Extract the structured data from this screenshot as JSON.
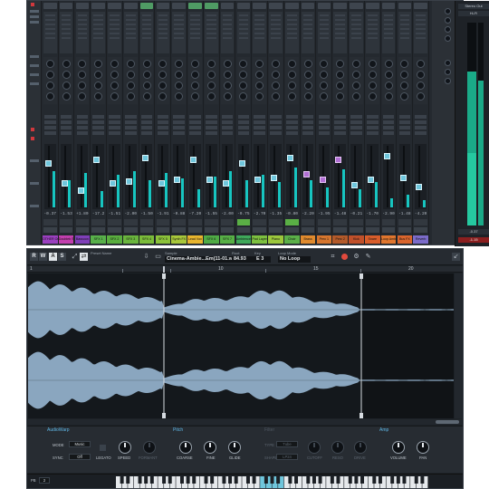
{
  "mixer": {
    "channel_values": [
      "-0.37",
      "-1.53",
      "+1.80",
      "-17.2",
      "-1.51",
      "-2.00",
      "-1.50",
      "-1.91",
      "-0.88",
      "-7.20",
      "-1.55",
      "-2.00",
      "-0.75",
      "-2.70",
      "-1.35",
      "-0.80",
      "-2.20",
      "-1.95",
      "-1.48",
      "-0.21",
      "-1.70",
      "-2.90",
      "-1.48",
      "-4.20"
    ],
    "channel_labels": [
      "OTHER Orch",
      "Doubleb Strings",
      "Bassoon",
      "SFX 1",
      "SFX 2",
      "SFX 3",
      "SFX 4",
      "SFX 5",
      "Synth FX",
      "Lead Vox",
      "SFX 6",
      "SFX 7",
      "Ambience",
      "Pad Layer",
      "Piano",
      "Choir",
      "Brass",
      "Perc 1",
      "Perc 2",
      "Kick",
      "Snare",
      "Loop Amb",
      "Bus FX",
      "Reverb"
    ],
    "label_colors": [
      "#9a3fbf",
      "#c23fae",
      "#7f3fb8",
      "#58b04a",
      "#5aae3f",
      "#6ab53d",
      "#7bbc3a",
      "#8cc23a",
      "#a8c73a",
      "#e8b52e",
      "#4fab45",
      "#57b046",
      "#3fa85a",
      "#7dc03f",
      "#9cc73c",
      "#5baf48",
      "#e08a2d",
      "#d6762e",
      "#b35a2a",
      "#c0502a",
      "#d85d2b",
      "#e0762e",
      "#d9652d",
      "#7b6bc9"
    ],
    "output_title": "Stereo Out",
    "output_sub": "Hi-Fi",
    "output_read": "-0.37",
    "output_clip": "-1.15"
  },
  "sampler": {
    "toolbar": {
      "btn_r": "R",
      "btn_w": "W",
      "btn_a": "A",
      "btn_s": "S",
      "preset_label": "Preset Name",
      "sample_label": "Sample",
      "sample_name": "Cinema-Ambie...Em(11-01.wav",
      "root_label": "Root",
      "root_value": "84.93",
      "key_label": "Key",
      "key_value": "E 3",
      "loop_label": "Loop Mode",
      "loop_value": "No Loop"
    },
    "ruler_marks": [
      "1",
      "10",
      "15",
      "20"
    ],
    "sections": {
      "audiowarp": "AudioWarp",
      "pitch": "Pitch",
      "filter": "Filter",
      "amp": "Amp"
    },
    "controls": {
      "mode_label": "MODE",
      "mode_value": "Music",
      "sync_label": "SYNC",
      "sync_value": "Off",
      "legato": "LEGATO",
      "speed": "SPEED",
      "formant": "FORMANT",
      "coarse": "COARSE",
      "fine": "FINE",
      "glide": "GLIDE",
      "type_label": "TYPE",
      "type_value": "Tube",
      "shape_label": "SHAPE",
      "shape_value": "LP24",
      "cutoff": "CUTOFF",
      "reso": "RESO",
      "drive": "DRIVE",
      "volume": "VOLUME",
      "pan": "PAN"
    },
    "keyboard": {
      "pb_label": "PB",
      "pb_value": "2",
      "octaves": [
        "C-1",
        "C0",
        "C1",
        "C2",
        "C3",
        "C4",
        "C5",
        "C6",
        "C7"
      ]
    },
    "colors": {
      "waveform": "#8aa6bf",
      "waveform_dark": "#596c7d",
      "accent": "#5fb7e6",
      "meter": "#17c5c0"
    }
  }
}
